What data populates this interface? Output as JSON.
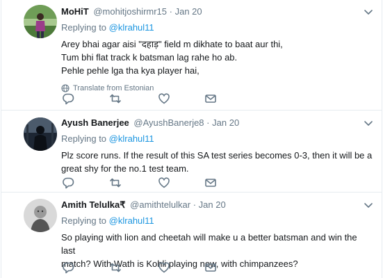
{
  "tweets": [
    {
      "name": "MoHiT",
      "handle": "@mohitjoshirmr15",
      "separator": "·",
      "date": "Jan 20",
      "replying_to_label": "Replying to",
      "replying_to_mention": "@klrahul11",
      "lines": [
        "Arey bhai agar aisi \"दहाड़\" field m dikhate to baat aur thi,",
        "Tum bhi flat track k batsman lag rahe ho ab.",
        "Pehle pehle lga tha kya player hai,"
      ],
      "translate_label": "Translate from Estonian",
      "avatar_colors": [
        "#a8c98f",
        "#4d7a3a",
        "#9b3d8a"
      ]
    },
    {
      "name": "Ayush Banerjee",
      "handle": "@AyushBanerje8",
      "separator": "·",
      "date": "Jan 20",
      "replying_to_label": "Replying to",
      "replying_to_mention": "@klrahul11",
      "lines": [
        "Plz score runs. If the result of this SA test series becomes 0-3, then it will be a",
        "great shy for the no.1 test team."
      ],
      "avatar_colors": [
        "#1d2633",
        "#4b5a6b",
        "#0c1016"
      ]
    },
    {
      "name": "Amith Telulka₹",
      "handle": "@amithtelulkar",
      "separator": "·",
      "date": "Jan 20",
      "replying_to_label": "Replying to",
      "replying_to_mention": "@klrahul11",
      "lines": [
        "So playing with lion and cheetah will make u a better batsman and win the last",
        "match? With Wath is Kohli playing now, with chimpanzees?"
      ],
      "avatar_colors": [
        "#d9d9d9",
        "#9a9a9a",
        "#555555"
      ]
    }
  ],
  "icons": {
    "reply": "reply-icon",
    "retweet": "retweet-icon",
    "like": "heart-icon",
    "dm": "direct-message-icon",
    "caret": "chevron-down-icon",
    "translate": "globe-icon"
  },
  "colors": {
    "link": "#1b95e0",
    "secondary": "#657786",
    "primary_text": "#14171a",
    "border": "#e6ecf0"
  }
}
